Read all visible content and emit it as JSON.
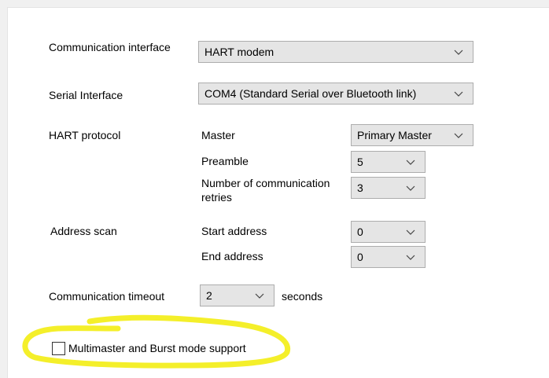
{
  "communication": {
    "interface_label": "Communication interface",
    "interface_value": "HART modem",
    "serial_label": "Serial Interface",
    "serial_value": "COM4 (Standard Serial over Bluetooth link)"
  },
  "hart": {
    "section_label": "HART protocol",
    "master_label": "Master",
    "master_value": "Primary Master",
    "preamble_label": "Preamble",
    "preamble_value": "5",
    "retries_label_line1": "Number of communication",
    "retries_label_line2": "retries",
    "retries_value": "3"
  },
  "address_scan": {
    "section_label": "Address scan",
    "start_label": "Start address",
    "start_value": "0",
    "end_label": "End address",
    "end_value": "0"
  },
  "timeout": {
    "label": "Communication timeout",
    "value": "2",
    "unit": "seconds"
  },
  "options": {
    "multimaster_label": "Multimaster and Burst mode support",
    "multimaster_checked": false
  },
  "icons": {
    "dropdown": "chevron-down-icon",
    "checkbox": "checkbox-icon"
  },
  "colors": {
    "combo_bg": "#e5e5e5",
    "combo_border": "#adadad",
    "highlight": "#f3ee1f"
  }
}
